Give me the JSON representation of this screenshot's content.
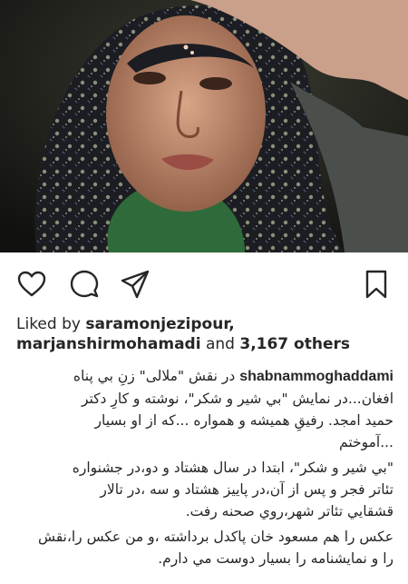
{
  "post": {
    "photo_alt": "photo",
    "liked_by_prefix": "Liked by ",
    "liked_user_1": "saramonjezipour,",
    "liked_user_2": "marjanshirmohamadi",
    "liked_and": " and ",
    "liked_others": "3,167 others",
    "author": "shabnammoghaddami",
    "caption_line_1": "در نقش \"ملالی\" زنِ بي پناه",
    "caption_line_2": "افغان...در نمايش \"بي شير و شكر\"، نوشته و كارِ دكتر",
    "caption_line_3": "حميد امجد. رفيقِ هميشه و همواره ...كه از او بسيار",
    "caption_line_4": "...آموختم",
    "caption_line_5": "\"بي شير و شكر\"، ابتدا در سال هشتاد و دو،در جشنواره",
    "caption_line_6": "تئاتر فجر و پس از آن،در پاييز هشتاد و سه ،در تالار",
    "caption_line_7": "قشقايي تئاتر شهر،روي صحنه رفت.",
    "caption_line_8": "عكس را هم مسعود خان پاكدل برداشته ،و من عكس را،نقش",
    "caption_line_9": "را و نمايشنامه را بسيار دوست مي دارم."
  },
  "icons": {
    "like": "heart-icon",
    "comment": "comment-icon",
    "share": "paper-plane-icon",
    "save": "bookmark-icon"
  },
  "colors": {
    "text": "#262626",
    "background": "#ffffff"
  }
}
